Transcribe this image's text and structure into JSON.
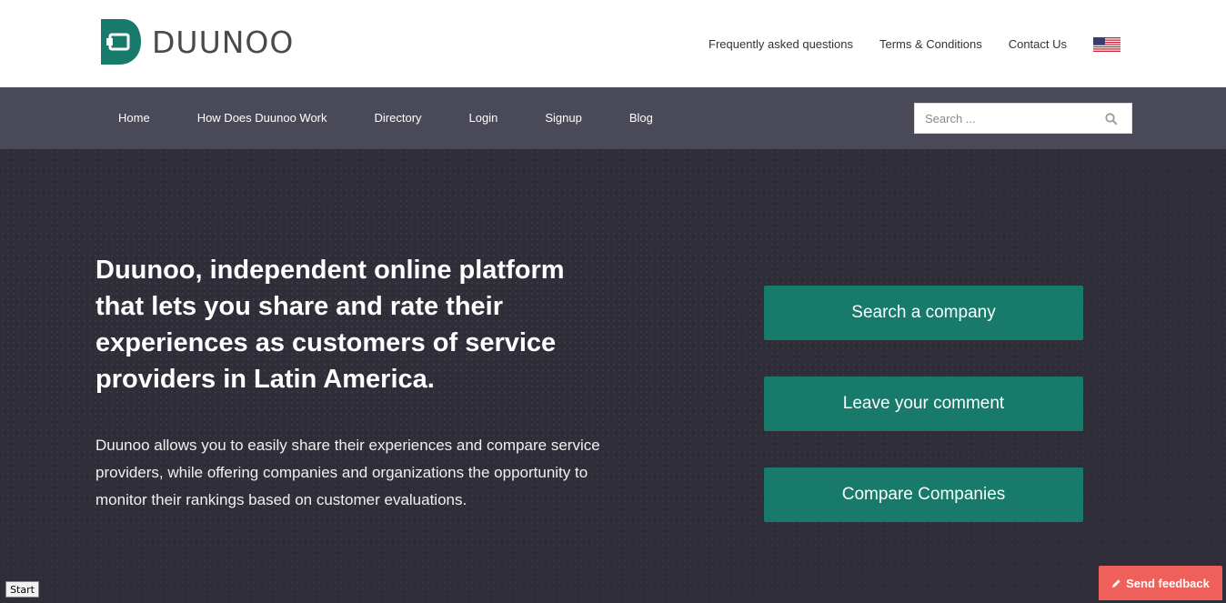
{
  "brand": {
    "name": "DUUNOO",
    "logo_color": "#177a6b"
  },
  "toplinks": [
    {
      "label": "Frequently asked questions"
    },
    {
      "label": "Terms & Conditions"
    },
    {
      "label": "Contact Us"
    }
  ],
  "language": {
    "flag": "us-flag-icon"
  },
  "nav": [
    {
      "label": "Home"
    },
    {
      "label": "How Does Duunoo Work"
    },
    {
      "label": "Directory"
    },
    {
      "label": "Login"
    },
    {
      "label": "Signup"
    },
    {
      "label": "Blog"
    }
  ],
  "search": {
    "placeholder": "Search ...",
    "icon": "search-icon"
  },
  "hero": {
    "headline": "Duunoo, independent online platform that lets you share and rate their experiences as customers of service providers in Latin America.",
    "description": "Duunoo allows you to easily share their experiences and compare service providers, while offering companies and organizations the opportunity to monitor their rankings based on customer evaluations."
  },
  "cta": [
    {
      "label": "Search a company"
    },
    {
      "label": "Leave your comment"
    },
    {
      "label": "Compare Companies"
    }
  ],
  "start_button": "Start",
  "feedback": {
    "label": "Send feedback",
    "icon": "pencil-icon",
    "color": "#f0605a"
  },
  "colors": {
    "nav_bg": "#4a4957",
    "hero_bg": "#2e2d38",
    "accent": "#177a6b"
  }
}
